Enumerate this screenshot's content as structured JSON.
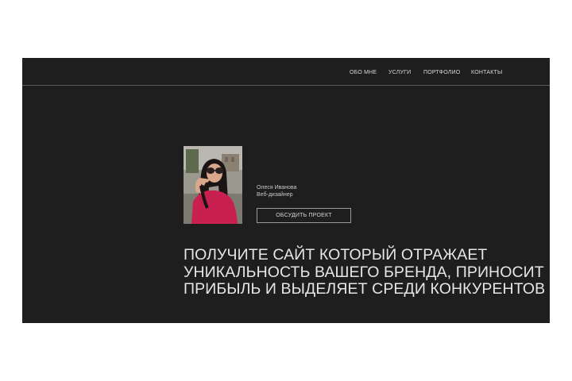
{
  "nav": {
    "items": [
      {
        "label": "ОБО МНЕ"
      },
      {
        "label": "УСЛУГИ"
      },
      {
        "label": "ПОРТФОЛИО"
      },
      {
        "label": "КОНТАКТЫ"
      }
    ]
  },
  "profile": {
    "name": "Олеся Иванова",
    "role": "Веб-дизайнер",
    "photo_icon": "portrait-photo"
  },
  "cta": {
    "label": "ОБСУДИТЬ ПРОЕКТ"
  },
  "headline": {
    "lines": [
      "ПОЛУЧИТЕ САЙТ КОТОРЫЙ ОТРАЖАЕТ",
      "УНИКАЛЬНОСТЬ ВАШЕГО БРЕНДА, ПРИНОСИТ",
      "ПРИБЫЛЬ И ВЫДЕЛЯЕТ СРЕДИ КОНКУРЕНТОВ"
    ]
  },
  "colors": {
    "page_background": "#ffffff",
    "frame_background": "#1f1e1f",
    "text": "#e6e6e6",
    "accent_shirt": "#c8204f"
  }
}
